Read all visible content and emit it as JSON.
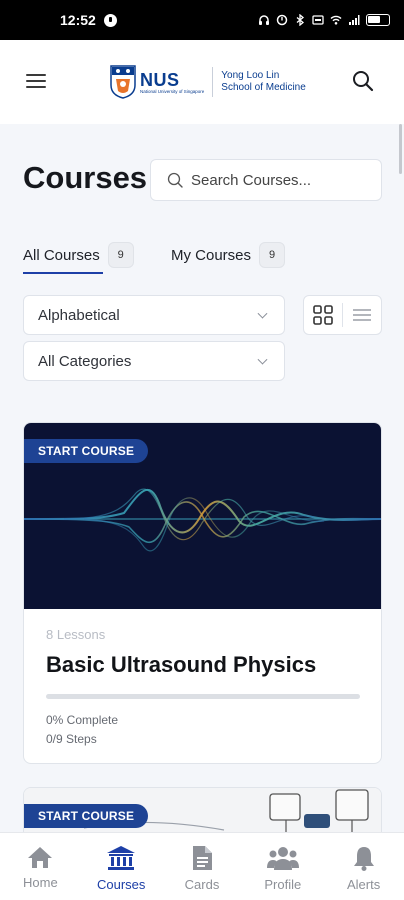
{
  "status_bar": {
    "time": "12:52",
    "icons": [
      "headphones-icon",
      "alarm-icon",
      "bluetooth-icon",
      "data-icon",
      "wifi-icon",
      "signal-icon",
      "battery-icon"
    ]
  },
  "header": {
    "logo": {
      "org": "NUS",
      "org_full": "National University of Singapore",
      "school_line1": "Yong Loo Lin",
      "school_line2": "School of Medicine"
    }
  },
  "page": {
    "title": "Courses",
    "search_placeholder": "Search Courses..."
  },
  "tabs": [
    {
      "label": "All Courses",
      "count": "9",
      "active": true
    },
    {
      "label": "My Courses",
      "count": "9",
      "active": false
    }
  ],
  "filters": {
    "order_selected": "Alphabetical",
    "category_selected": "All Categories"
  },
  "courses": [
    {
      "badge": "START COURSE",
      "lessons": "8 Lessons",
      "title": "Basic Ultrasound Physics",
      "progress_percent": 0,
      "progress_text": "0% Complete",
      "steps_text": "0/9 Steps"
    },
    {
      "badge": "START COURSE"
    }
  ],
  "bottom_nav": [
    {
      "label": "Home",
      "icon": "home-icon",
      "active": false
    },
    {
      "label": "Courses",
      "icon": "courses-icon",
      "active": true
    },
    {
      "label": "Cards",
      "icon": "cards-icon",
      "active": false
    },
    {
      "label": "Profile",
      "icon": "profile-icon",
      "active": false
    },
    {
      "label": "Alerts",
      "icon": "bell-icon",
      "active": false
    }
  ],
  "colors": {
    "accent": "#1d3fa7",
    "badge": "#1e4394",
    "brand": "#0a3d8f",
    "inactive": "#8d9097"
  }
}
